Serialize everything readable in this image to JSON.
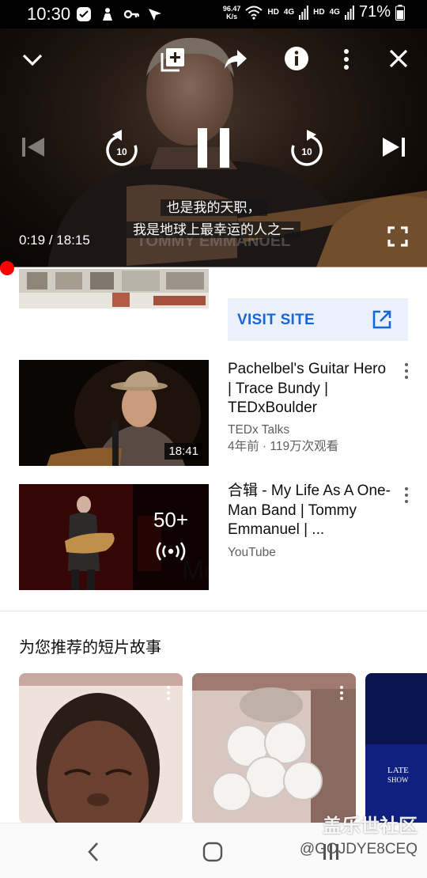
{
  "status_bar": {
    "time": "10:30",
    "net_speed_value": "96.47",
    "net_speed_unit": "K/s",
    "hd1": "HD",
    "net1": "4G",
    "hd2": "HD",
    "net2": "4G",
    "battery": "71%"
  },
  "player": {
    "subtitle_line1": "也是我的天职，",
    "subtitle_line2": "我是地球上最幸运的人之一",
    "current_time": "0:19",
    "separator": " / ",
    "duration": "18:15",
    "progress_fraction": 0.0175,
    "icons": [
      "chevron-down-icon",
      "add-to-playlist-icon",
      "share-icon",
      "info-icon",
      "more-vert-icon",
      "close-icon",
      "skip-previous-icon",
      "replay-10-icon",
      "pause-icon",
      "forward-10-icon",
      "skip-next-icon",
      "fullscreen-icon"
    ],
    "skip_seconds": "10"
  },
  "ad": {
    "visit_site_label": "VISIT SITE"
  },
  "videos": [
    {
      "title": "Pachelbel's Guitar Hero | Trace Bundy | TEDxBoulder",
      "channel": "TEDx Talks",
      "stats": "4年前 · 119万次观看",
      "duration": "18:41"
    },
    {
      "title": "合辑 - My Life As A One-Man Band | Tommy Emmanuel | ...",
      "channel": "YouTube",
      "playlist_count": "50+"
    }
  ],
  "shorts_shelf": {
    "title": "为您推荐的短片故事"
  },
  "watermark": {
    "line1": "盖乐世社区",
    "line2": "@GOJDYE8CEQ"
  },
  "colors": {
    "accent_red": "#ff0000",
    "link_blue": "#1967d2",
    "visit_bg": "#eaf1fb"
  }
}
